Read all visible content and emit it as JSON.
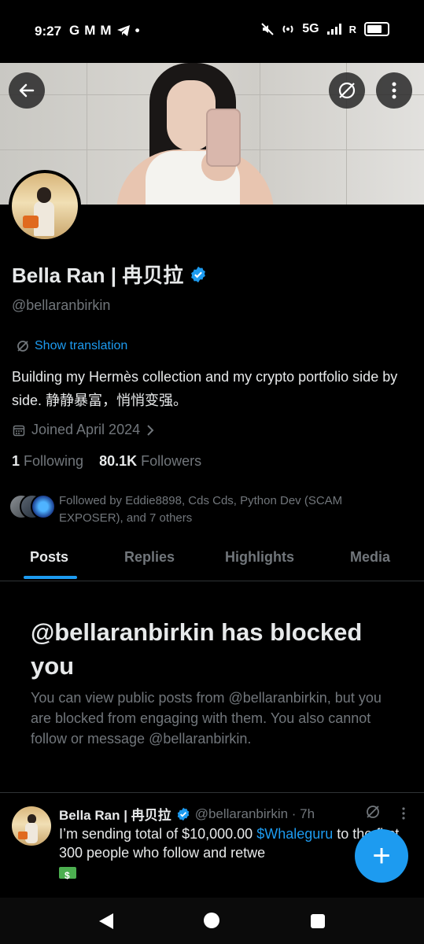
{
  "status_bar": {
    "time": "9:27",
    "left_icons": [
      "G",
      "M",
      "M",
      "telegram-icon",
      "•"
    ],
    "network": "5G",
    "carrier_suffix": "R"
  },
  "banner": {
    "back_icon": "arrow-left-icon",
    "translate_icon": "grok-icon",
    "more_icon": "more-vertical-icon"
  },
  "profile": {
    "display_name": "Bella Ran | 冉贝拉",
    "handle": "@bellaranbirkin",
    "show_translation": "Show translation",
    "bio": "Building my Hermès collection and my crypto portfolio side by side. 静静暴富，悄悄变强。",
    "joined": "Joined April 2024",
    "following_count": "1",
    "following_label": "Following",
    "followers_count": "80.1K",
    "followers_label": "Followers",
    "followed_by": "Followed by Eddie8898, Cds Cds, Python Dev (SCAM EXPOSER), and 7 others"
  },
  "tabs": [
    {
      "label": "Posts",
      "active": true
    },
    {
      "label": "Replies",
      "active": false
    },
    {
      "label": "Highlights",
      "active": false
    },
    {
      "label": "Media",
      "active": false
    }
  ],
  "blocked": {
    "title": "@bellaranbirkin has blocked you",
    "description": "You can view public posts from @bellaranbirkin, but you are blocked from engaging with them. You also cannot follow or message @bellaranbirkin."
  },
  "tweet": {
    "name": "Bella Ran | 冉贝拉",
    "handle_time": "@bellaranbirkin · 7h",
    "text_before": "I’m sending total of $10,000.00 ",
    "cashtag": "$Whaleguru",
    "text_after": " to the first 300 people who follow and retwe"
  },
  "fab": {
    "label": "+"
  },
  "colors": {
    "accent": "#1d9bf0",
    "background": "#000000",
    "muted": "#71767b"
  }
}
